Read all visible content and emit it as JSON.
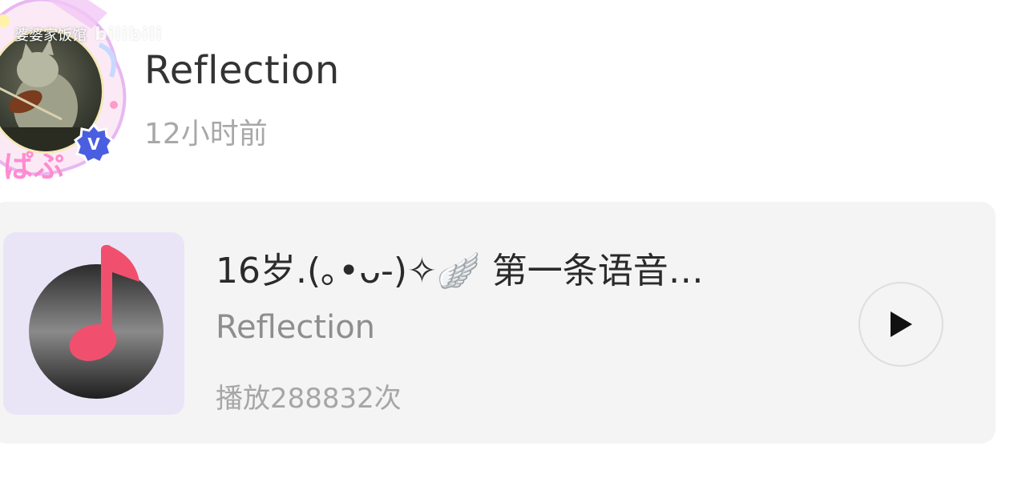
{
  "watermark": {
    "text": "婆婆家饭馆",
    "logo": "bilibili"
  },
  "post": {
    "author": "Reflection",
    "time": "12小时前",
    "verified_icon": "verified-v-badge"
  },
  "audio_card": {
    "title": "16岁.(｡•ᴗ-)✧🪽 第一条语音…",
    "artist": "Reflection",
    "plays": "播放288832次",
    "cover_icon": "music-note-disc",
    "play_icon": "play-triangle"
  },
  "colors": {
    "card_bg": "#f4f4f5",
    "cover_bg": "#e9e5f7",
    "note_red": "#f0506e",
    "verified_blue": "#4a5ee0"
  }
}
